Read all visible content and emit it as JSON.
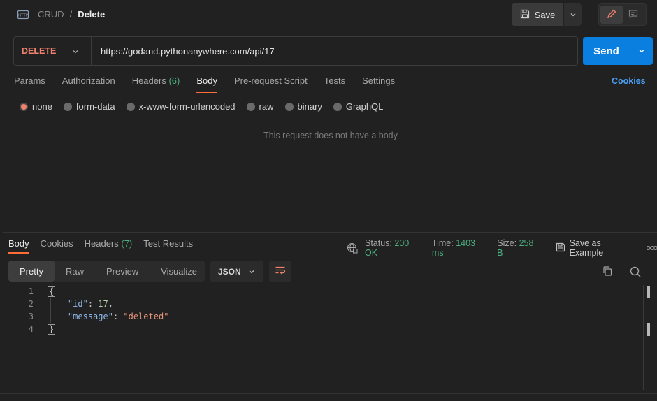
{
  "header": {
    "breadcrumb_parent": "CRUD",
    "breadcrumb_sep": "/",
    "breadcrumb_current": "Delete",
    "save_label": "Save"
  },
  "request": {
    "method": "DELETE",
    "url": "https://godand.pythonanywhere.com/api/17",
    "send_label": "Send",
    "tabs": [
      {
        "label": "Params"
      },
      {
        "label": "Authorization"
      },
      {
        "label": "Headers",
        "count": "(6)"
      },
      {
        "label": "Body",
        "active": true
      },
      {
        "label": "Pre-request Script"
      },
      {
        "label": "Tests"
      },
      {
        "label": "Settings"
      }
    ],
    "cookies_label": "Cookies",
    "body_types": [
      {
        "label": "none",
        "selected": true
      },
      {
        "label": "form-data"
      },
      {
        "label": "x-www-form-urlencoded"
      },
      {
        "label": "raw"
      },
      {
        "label": "binary"
      },
      {
        "label": "GraphQL"
      }
    ],
    "empty_message": "This request does not have a body"
  },
  "response": {
    "tabs": [
      {
        "label": "Body",
        "active": true
      },
      {
        "label": "Cookies"
      },
      {
        "label": "Headers",
        "count": "(7)"
      },
      {
        "label": "Test Results"
      }
    ],
    "status_label": "Status:",
    "status_value": "200 OK",
    "time_label": "Time:",
    "time_value": "1403 ms",
    "size_label": "Size:",
    "size_value": "258 B",
    "save_example_label": "Save as Example",
    "more_label": "ooo",
    "view_modes": [
      "Pretty",
      "Raw",
      "Preview",
      "Visualize"
    ],
    "format": "JSON",
    "code_lines": [
      {
        "n": "1"
      },
      {
        "n": "2",
        "key": "\"id\"",
        "value": "17",
        "type": "num",
        "trail": ","
      },
      {
        "n": "3",
        "key": "\"message\"",
        "value": "\"deleted\"",
        "type": "str",
        "trail": ""
      },
      {
        "n": "4"
      }
    ],
    "open_brace": "{",
    "close_brace": "}"
  },
  "colors": {
    "accent": "#ff6c37",
    "send": "#0b7fe0",
    "method": "#f0826c",
    "success": "#4cae7e",
    "link": "#4a9ff5"
  }
}
